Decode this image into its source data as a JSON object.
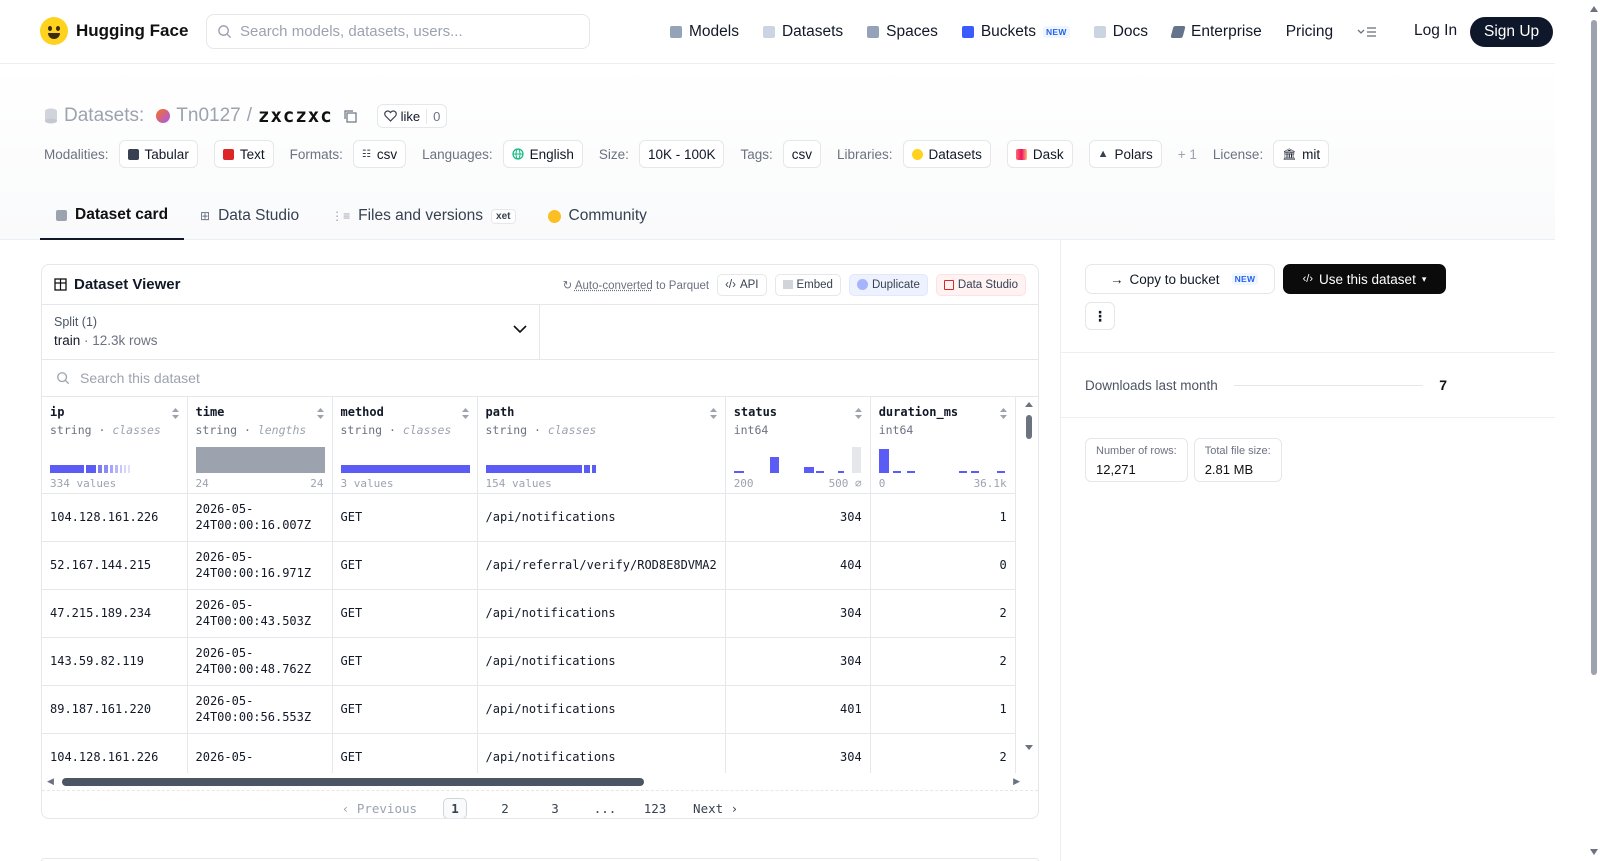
{
  "nav": {
    "logo_text": "Hugging Face",
    "search_placeholder": "Search models, datasets, users...",
    "links": [
      {
        "label": "Models",
        "color": "#94a3b8"
      },
      {
        "label": "Datasets",
        "color": "#cbd5e1"
      },
      {
        "label": "Spaces",
        "color": "#94a3b8"
      },
      {
        "label": "Buckets",
        "color": "#3b5bfd",
        "badge": "NEW"
      },
      {
        "label": "Docs",
        "color": "#cbd5e1"
      },
      {
        "label": "Enterprise",
        "color": "#64748b"
      },
      {
        "label": "Pricing"
      }
    ],
    "login": "Log In",
    "signup": "Sign Up"
  },
  "header": {
    "prefix": "Datasets:",
    "owner": "Tn0127",
    "separator": "/",
    "name": "zxczxc",
    "like_label": "like",
    "like_count": "0",
    "tags": {
      "modalities_label": "Modalities:",
      "modalities": [
        "Tabular",
        "Text"
      ],
      "formats_label": "Formats:",
      "formats": [
        "csv"
      ],
      "languages_label": "Languages:",
      "languages": [
        "English"
      ],
      "size_label": "Size:",
      "size": "10K - 100K",
      "tags_label": "Tags:",
      "tags": [
        "csv"
      ],
      "libraries_label": "Libraries:",
      "libraries": [
        "Datasets",
        "Dask",
        "Polars"
      ],
      "libraries_more": "+ 1",
      "license_label": "License:",
      "license": "mit"
    },
    "tabs": [
      {
        "label": "Dataset card",
        "active": true
      },
      {
        "label": "Data Studio"
      },
      {
        "label": "Files and versions",
        "badge": "xet"
      },
      {
        "label": "Community"
      }
    ]
  },
  "viewer": {
    "title": "Dataset Viewer",
    "auto_converted": "Auto-converted",
    "to_parquet": " to Parquet",
    "api": "API",
    "embed": "Embed",
    "duplicate": "Duplicate",
    "data_studio": "Data Studio",
    "split_label": "Split (1)",
    "split_name": "train",
    "split_rows": "12.3k rows",
    "search_placeholder": "Search this dataset",
    "columns": [
      {
        "name": "ip",
        "type": "string",
        "stat": "classes",
        "foot_left": "334 values",
        "foot_right": ""
      },
      {
        "name": "time",
        "type": "string",
        "stat": "lengths",
        "foot_left": "24",
        "foot_right": "24"
      },
      {
        "name": "method",
        "type": "string",
        "stat": "classes",
        "foot_left": "3 values",
        "foot_right": ""
      },
      {
        "name": "path",
        "type": "string",
        "stat": "classes",
        "foot_left": "154 values",
        "foot_right": ""
      },
      {
        "name": "status",
        "type": "int64",
        "stat": "",
        "foot_left": "200",
        "foot_right": "500 ⌀"
      },
      {
        "name": "duration_ms",
        "type": "int64",
        "stat": "",
        "foot_left": "0",
        "foot_right": "36.1k"
      }
    ],
    "rows": [
      [
        "104.128.161.226",
        "2026-05-\n24T00:00:16.007Z",
        "GET",
        "/api/notifications",
        "304",
        "1"
      ],
      [
        "52.167.144.215",
        "2026-05-\n24T00:00:16.971Z",
        "GET",
        "/api/referral/verify/ROD8E8DVMA2",
        "404",
        "0"
      ],
      [
        "47.215.189.234",
        "2026-05-\n24T00:00:43.503Z",
        "GET",
        "/api/notifications",
        "304",
        "2"
      ],
      [
        "143.59.82.119",
        "2026-05-\n24T00:00:48.762Z",
        "GET",
        "/api/notifications",
        "304",
        "2"
      ],
      [
        "89.187.161.220",
        "2026-05-\n24T00:00:56.553Z",
        "GET",
        "/api/notifications",
        "401",
        "1"
      ],
      [
        "104.128.161.226",
        "2026-05-",
        "GET",
        "/api/notifications",
        "304",
        "2"
      ]
    ],
    "pager": {
      "previous": "Previous",
      "pages": [
        "1",
        "2",
        "3",
        "...",
        "123"
      ],
      "current": "1",
      "next": "Next"
    }
  },
  "sidebar": {
    "copy_to_bucket": "Copy to bucket",
    "copy_badge": "NEW",
    "use_dataset": "Use this dataset",
    "downloads_label": "Downloads last month",
    "downloads_value": "7",
    "rows_label": "Number of rows:",
    "rows_value": "12,271",
    "size_label": "Total file size:",
    "size_value": "2.81 MB"
  },
  "colors": {
    "accent": "#5b5bf5",
    "histogram_gray": "#9ca3af",
    "dark_button": "#0b0b0b"
  }
}
